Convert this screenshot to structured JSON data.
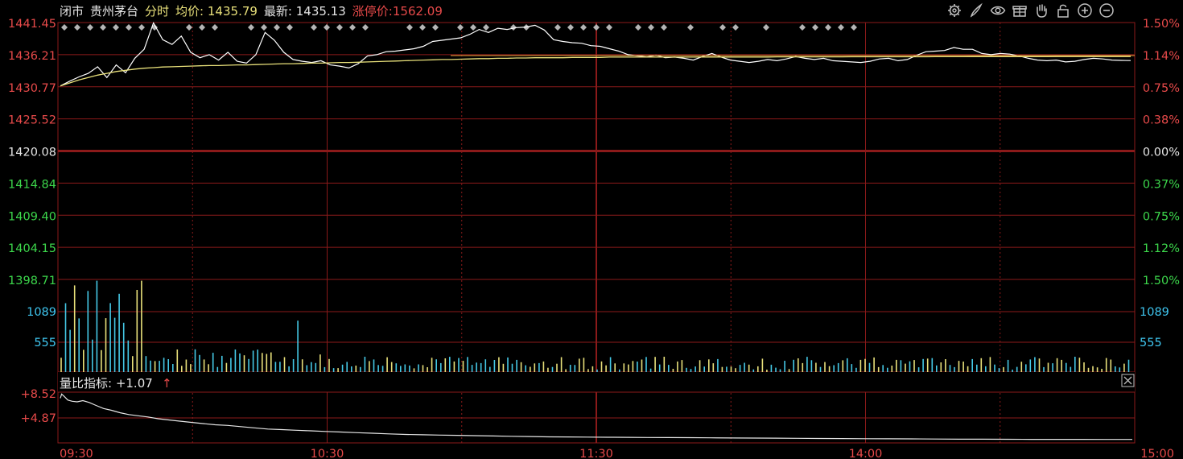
{
  "header": {
    "status": "闭市",
    "name": "贵州茅台",
    "mode": "分时",
    "avg_label": "均价:",
    "avg_value": "1435.79",
    "last_label": "最新:",
    "last_value": "1435.13",
    "limit_label": "涨停价:",
    "limit_value": "1562.09"
  },
  "toolbar": [
    "gear-icon",
    "brush-icon",
    "eye-icon",
    "gift-icon",
    "hand-icon",
    "lock-icon",
    "zoom-in-icon",
    "zoom-out-icon"
  ],
  "colors": {
    "background": "#000000",
    "grid": "#8b1a1a",
    "up": "#e84a4a",
    "down": "#3cd64b",
    "price_line": "#ffffff",
    "avg_line": "#e8e07a",
    "volume_up": "#e8e07a",
    "volume_down": "#45c9e6",
    "volume_label": "#3fc6f0",
    "ratio_label": "#e84a4a"
  },
  "chart_data": [
    {
      "type": "line",
      "name": "intraday-price",
      "title": "贵州茅台 分时",
      "preclose": 1420.08,
      "ylim": [
        1398.71,
        1441.45
      ],
      "y_ticks_left": [
        "1441.45",
        "1436.21",
        "1430.77",
        "1425.52",
        "1420.08",
        "1414.84",
        "1409.40",
        "1404.15",
        "1398.71"
      ],
      "y_ticks_right": [
        "1.50%",
        "1.14%",
        "0.75%",
        "0.38%",
        "0.00%",
        "0.37%",
        "0.75%",
        "1.12%",
        "1.50%"
      ],
      "x_ticks": [
        "09:30",
        "10:30",
        "11:30",
        "14:00",
        "15:00"
      ],
      "series": [
        {
          "values": [
            1430.9,
            1431.7,
            1432.4,
            1433.0,
            1434.1,
            1432.3,
            1434.4,
            1433.1,
            1435.5,
            1437.0,
            1441.4,
            1438.6,
            1437.8,
            1439.2,
            1436.5,
            1435.6,
            1436.1,
            1435.2,
            1436.5,
            1435.0,
            1434.7,
            1436.1,
            1439.8,
            1438.5,
            1436.5,
            1435.3,
            1435.0,
            1434.8,
            1435.1,
            1434.4,
            1434.2,
            1433.9,
            1434.6,
            1435.9,
            1436.1,
            1436.6,
            1436.7,
            1436.9,
            1437.1,
            1437.5,
            1438.3,
            1438.5,
            1438.7,
            1438.9,
            1439.5,
            1440.3,
            1439.8,
            1440.5,
            1440.3,
            1440.6,
            1440.7,
            1441.0,
            1440.2,
            1438.6,
            1438.3,
            1438.1,
            1438.0,
            1437.6,
            1437.5,
            1437.1,
            1436.7,
            1436.1,
            1435.9,
            1435.7,
            1436.0,
            1435.6,
            1435.7,
            1435.5,
            1435.2,
            1435.8,
            1436.3,
            1435.7,
            1435.2,
            1435.0,
            1434.8,
            1435.0,
            1435.3,
            1435.1,
            1435.4,
            1435.8,
            1435.5,
            1435.3,
            1435.5,
            1435.1,
            1435.0,
            1434.9,
            1434.8,
            1435.0,
            1435.4,
            1435.5,
            1435.1,
            1435.3,
            1436.0,
            1436.6,
            1436.7,
            1436.8,
            1437.3,
            1437.0,
            1437.0,
            1436.3,
            1436.1,
            1436.3,
            1436.2,
            1435.9,
            1435.5,
            1435.2,
            1435.1,
            1435.2,
            1434.9,
            1435.0,
            1435.3,
            1435.5,
            1435.4,
            1435.2,
            1435.15,
            1435.13
          ],
          "name": "最新"
        },
        {
          "values": [
            1430.9,
            1431.4,
            1431.9,
            1432.3,
            1432.7,
            1433.0,
            1433.3,
            1433.5,
            1433.7,
            1433.85,
            1433.95,
            1434.05,
            1434.1,
            1434.15,
            1434.2,
            1434.25,
            1434.3,
            1434.3,
            1434.35,
            1434.4,
            1434.4,
            1434.45,
            1434.5,
            1434.55,
            1434.6,
            1434.6,
            1434.65,
            1434.7,
            1434.7,
            1434.75,
            1434.8,
            1434.8,
            1434.85,
            1434.9,
            1434.95,
            1435.0,
            1435.05,
            1435.1,
            1435.15,
            1435.2,
            1435.25,
            1435.3,
            1435.3,
            1435.35,
            1435.4,
            1435.45,
            1435.45,
            1435.5,
            1435.5,
            1435.55,
            1435.55,
            1435.6,
            1435.6,
            1435.6,
            1435.6,
            1435.65,
            1435.65,
            1435.65,
            1435.65,
            1435.7,
            1435.7,
            1435.7,
            1435.7,
            1435.7,
            1435.7,
            1435.7,
            1435.7,
            1435.7,
            1435.7,
            1435.72,
            1435.72,
            1435.72,
            1435.72,
            1435.72,
            1435.72,
            1435.72,
            1435.72,
            1435.74,
            1435.74,
            1435.74,
            1435.74,
            1435.74,
            1435.74,
            1435.74,
            1435.74,
            1435.75,
            1435.75,
            1435.75,
            1435.75,
            1435.75,
            1435.76,
            1435.76,
            1435.76,
            1435.76,
            1435.77,
            1435.77,
            1435.77,
            1435.77,
            1435.78,
            1435.78,
            1435.78,
            1435.78,
            1435.78,
            1435.78,
            1435.78,
            1435.78,
            1435.78,
            1435.79,
            1435.79,
            1435.79,
            1435.79,
            1435.79,
            1435.79,
            1435.79,
            1435.79,
            1435.79
          ],
          "name": "均价"
        }
      ],
      "event_markers": 45
    },
    {
      "type": "bar",
      "name": "volume",
      "y_ticks": [
        "1089",
        "555"
      ],
      "ylim": [
        0,
        1623
      ],
      "count": 240,
      "marker": "volume"
    },
    {
      "type": "line",
      "name": "volume-ratio",
      "label": "量比指标:",
      "value": "+1.07",
      "arrow": "↑",
      "y_ticks": [
        "+8.52",
        "+4.87"
      ],
      "ylim": [
        0.5,
        8.9
      ],
      "values": [
        7.9,
        8.6,
        8.2,
        7.6,
        7.4,
        7.3,
        7.5,
        7.2,
        6.7,
        6.2,
        5.9,
        5.5,
        5.2,
        5.0,
        4.8,
        4.5,
        4.3,
        4.1,
        3.9,
        3.7,
        3.5,
        3.4,
        3.2,
        3.0,
        2.8,
        2.7,
        2.6,
        2.5,
        2.4,
        2.3,
        2.2,
        2.1,
        2.0,
        1.9,
        1.85,
        1.8,
        1.75,
        1.7,
        1.65,
        1.6,
        1.55,
        1.5,
        1.48,
        1.46,
        1.44,
        1.42,
        1.4,
        1.38,
        1.36,
        1.34,
        1.32,
        1.3,
        1.28,
        1.26,
        1.24,
        1.22,
        1.2,
        1.18,
        1.16,
        1.14,
        1.12,
        1.11,
        1.1,
        1.09,
        1.08,
        1.08,
        1.07,
        1.07
      ]
    }
  ]
}
